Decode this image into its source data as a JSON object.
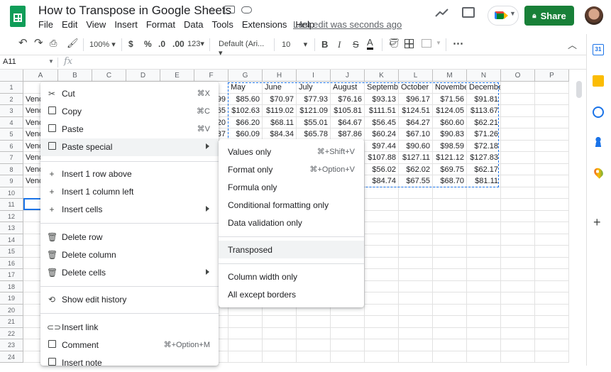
{
  "window": {
    "title": "How to Transpose in Google Sheets",
    "last_edit": "Last edit was seconds ago",
    "share_label": "Share"
  },
  "menubar": [
    "File",
    "Edit",
    "View",
    "Insert",
    "Format",
    "Data",
    "Tools",
    "Extensions",
    "Help"
  ],
  "toolbar": {
    "zoom": "100%",
    "currency": "$",
    "percent": "%",
    "decrease_decimals": ".0",
    "increase_decimals": ".00",
    "more_formats": "123",
    "font": "Default (Ari...",
    "font_size": "10",
    "bold": "B",
    "italic": "I",
    "strike": "S",
    "text_color": "A",
    "more": "⋯"
  },
  "formula_bar": {
    "name_box": "A11",
    "fx": "fx",
    "value": ""
  },
  "columns": [
    "A",
    "B",
    "C",
    "D",
    "E",
    "F",
    "G",
    "H",
    "I",
    "J",
    "K",
    "L",
    "M",
    "N",
    "O",
    "P"
  ],
  "rows": [
    "1",
    "2",
    "3",
    "4",
    "5",
    "6",
    "7",
    "8",
    "9",
    "10",
    "11",
    "12",
    "13",
    "14",
    "15",
    "16",
    "17",
    "18",
    "19",
    "20",
    "21",
    "22",
    "23",
    "24"
  ],
  "sheet": {
    "col_a_values": [
      "",
      "Vend",
      "Vend",
      "Vend",
      "Vend",
      "Vend",
      "Vend",
      "Vend",
      "Vend"
    ],
    "col_f_partial": [
      "",
      "99",
      "65",
      "20",
      "37"
    ],
    "headers": [
      "May",
      "June",
      "July",
      "August",
      "September",
      "October",
      "November",
      "December"
    ],
    "data": [
      [
        "$85.60",
        "$70.97",
        "$77.93",
        "$76.16",
        "$93.13",
        "$96.17",
        "$71.56",
        "$91.81"
      ],
      [
        "$102.63",
        "$119.02",
        "$121.09",
        "$105.81",
        "$111.51",
        "$124.51",
        "$124.05",
        "$113.67"
      ],
      [
        "$66.20",
        "$68.11",
        "$55.01",
        "$64.67",
        "$56.45",
        "$64.27",
        "$60.60",
        "$62.21"
      ],
      [
        "$60.09",
        "$84.34",
        "$65.78",
        "$87.86",
        "$60.24",
        "$67.10",
        "$90.83",
        "$71.26"
      ],
      [
        "",
        "",
        "",
        "",
        "$97.44",
        "$90.60",
        "$98.59",
        "$72.18"
      ],
      [
        "",
        "",
        "",
        "",
        "$107.88",
        "$127.11",
        "$121.12",
        "$127.83"
      ],
      [
        "",
        "",
        "",
        "",
        "$56.02",
        "$62.02",
        "$69.75",
        "$62.17"
      ],
      [
        "",
        "",
        "",
        "",
        "$84.74",
        "$67.55",
        "$68.70",
        "$81.11"
      ]
    ]
  },
  "context_menu": {
    "cut": {
      "label": "Cut",
      "shortcut": "⌘X"
    },
    "copy": {
      "label": "Copy",
      "shortcut": "⌘C"
    },
    "paste": {
      "label": "Paste",
      "shortcut": "⌘V"
    },
    "paste_special": {
      "label": "Paste special"
    },
    "insert_row": {
      "label": "Insert 1 row above"
    },
    "insert_column": {
      "label": "Insert 1 column left"
    },
    "insert_cells": {
      "label": "Insert cells"
    },
    "delete_row": {
      "label": "Delete row"
    },
    "delete_column": {
      "label": "Delete column"
    },
    "delete_cells": {
      "label": "Delete cells"
    },
    "edit_history": {
      "label": "Show edit history"
    },
    "insert_link": {
      "label": "Insert link"
    },
    "comment": {
      "label": "Comment",
      "shortcut": "⌘+Option+M"
    },
    "insert_note": {
      "label": "Insert note"
    }
  },
  "paste_special_menu": {
    "values_only": {
      "label": "Values only",
      "shortcut": "⌘+Shift+V"
    },
    "format_only": {
      "label": "Format only",
      "shortcut": "⌘+Option+V"
    },
    "formula_only": {
      "label": "Formula only"
    },
    "conditional_formatting_only": {
      "label": "Conditional formatting only"
    },
    "data_validation_only": {
      "label": "Data validation only"
    },
    "transposed": {
      "label": "Transposed"
    },
    "column_width_only": {
      "label": "Column width only"
    },
    "all_except_borders": {
      "label": "All except borders"
    }
  },
  "side_panel": {
    "calendar_day": "31"
  },
  "colors": {
    "share_green": "#188038",
    "selection_blue": "#1a73e8",
    "sheets_green": "#0f9d58"
  }
}
